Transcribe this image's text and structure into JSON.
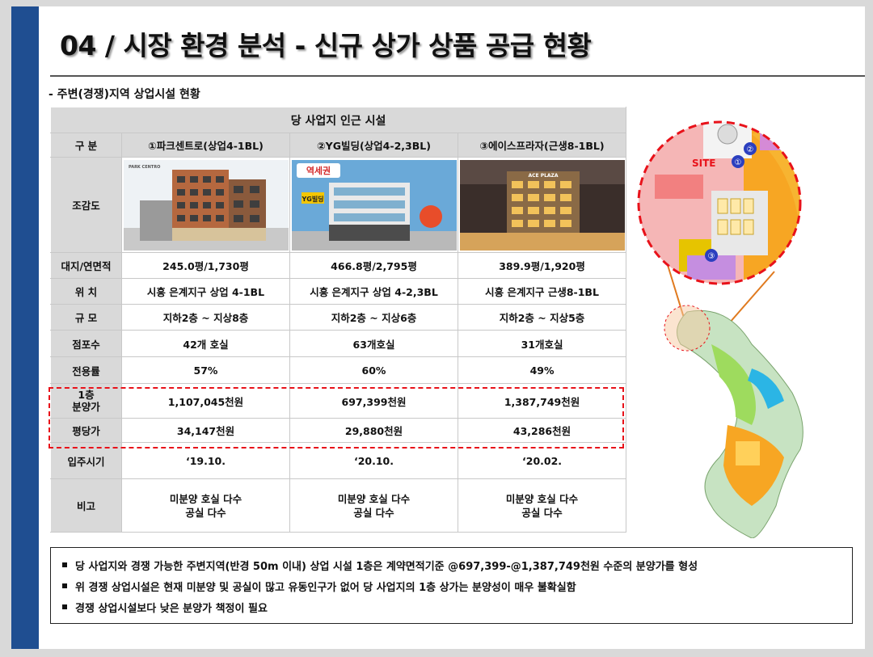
{
  "page": {
    "title": "04 / 시장 환경 분석 - 신규 상가 상품 공급 현황",
    "subtitle": "- 주변(경쟁)지역 상업시설 현황"
  },
  "table": {
    "group_header": "당 사업지 인근 시설",
    "row_labels": {
      "category": "구 분",
      "rendering": "조감도",
      "area": "대지/연면적",
      "location": "위 치",
      "scale": "규 모",
      "units": "점포수",
      "efficiency": "전용률",
      "price_1f": "1층\n분양가",
      "price_py": "평당가",
      "move_in": "입주시기",
      "remarks": "비고"
    },
    "columns": [
      {
        "name": "①파크센트로(상업4-1BL)",
        "image_caption": "PARK CENTRO",
        "area": "245.0평/1,730평",
        "location": "시흥 은계지구 상업 4-1BL",
        "scale": "지하2층 ~ 지상8층",
        "units": "42개 호실",
        "efficiency": "57%",
        "price_1f": "1,107,045천원",
        "price_py": "34,147천원",
        "move_in": "‘19.10.",
        "remarks": "미분양 호실 다수\n공실 다수"
      },
      {
        "name": "②YG빌딩(상업4-2,3BL)",
        "image_caption": "역세권",
        "image_caption2": "YG빌딩",
        "area": "466.8평/2,795평",
        "location": "시흥 은계지구 상업 4-2,3BL",
        "scale": "지하2층 ~ 지상6층",
        "units": "63개호실",
        "efficiency": "60%",
        "price_1f": "697,399천원",
        "price_py": "29,880천원",
        "move_in": "‘20.10.",
        "remarks": "미분양 호실 다수\n공실 다수"
      },
      {
        "name": "③에이스프라자(근생8-1BL)",
        "image_caption": "ACE PLAZA",
        "area": "389.9평/1,920평",
        "location": "시흥 은계지구 근생8-1BL",
        "scale": "지하2층 ~ 지상5층",
        "units": "31개호실",
        "efficiency": "49%",
        "price_1f": "1,387,749천원",
        "price_py": "43,286천원",
        "move_in": "‘20.02.",
        "remarks": "미분양 호실 다수\n공실 다수"
      }
    ]
  },
  "map": {
    "site_label": "SITE",
    "markers": [
      "①",
      "②",
      "③"
    ]
  },
  "notes": [
    "당 사업지와 경쟁 가능한 주변지역(반경 50m 이내) 상업 시설 1층은 계약면적기준 @697,399-@1,387,749천원 수준의 분양가를 형성",
    "위 경쟁 상업시설은 현재 미분양 및 공실이 많고 유동인구가 없어 당 사업지의 1층 상가는 분양성이 매우 불확실함",
    "경쟁 상업시설보다 낮은 분양가 책정이 필요"
  ],
  "colors": {
    "sidebar": "#1f4e91",
    "header_bg": "#d9d9d9",
    "highlight": "#e8121a"
  }
}
